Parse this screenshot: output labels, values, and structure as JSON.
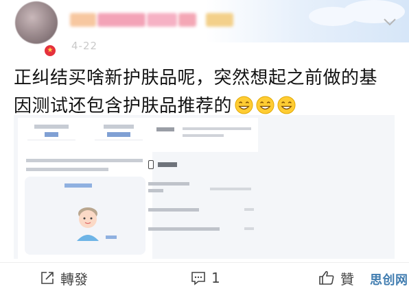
{
  "post": {
    "date": "4-22",
    "text_line1": "正纠结买啥新护肤品呢，突然想起之前做的基",
    "text_line2": "因测试还包含护肤品推荐的",
    "emojis": [
      "grin-emoji",
      "grin-emoji",
      "grin-emoji"
    ]
  },
  "actions": {
    "repost_label": "轉發",
    "comment_count": "1",
    "like_label": "贊"
  },
  "watermark": {
    "text": "思创网"
  },
  "colors": {
    "accent": "#4a78c2",
    "badge": "#e5313c",
    "emoji": "#ffcc33",
    "watermark": "#2d6fa8"
  }
}
